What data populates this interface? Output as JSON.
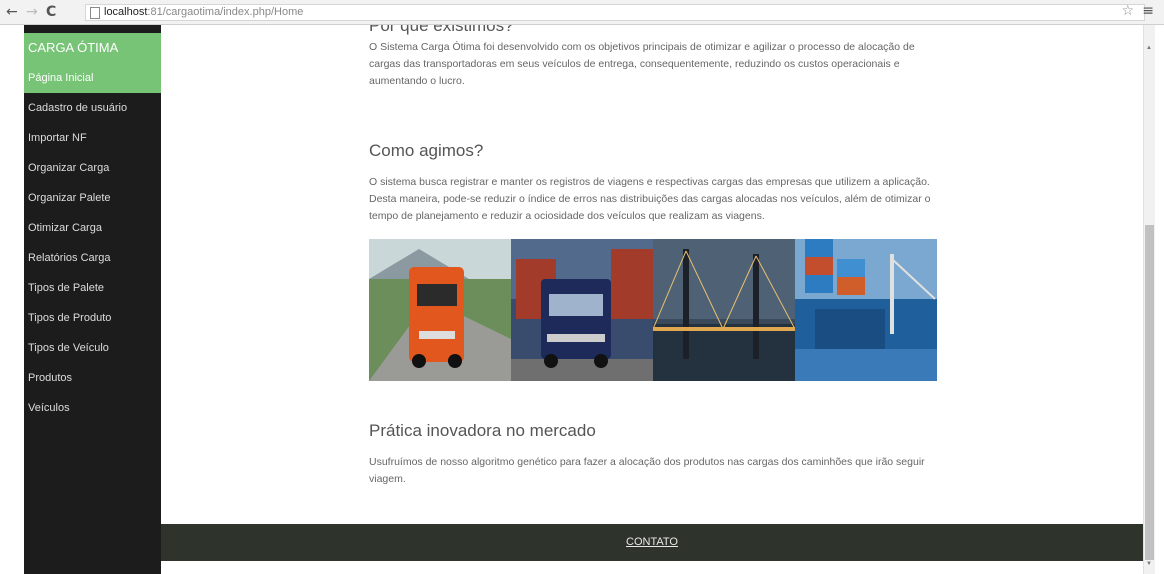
{
  "browser": {
    "url_host": "localhost",
    "url_path": ":81/cargaotima/index.php/Home"
  },
  "sidebar": {
    "brand": "CARGA ÓTIMA",
    "items": [
      {
        "label": "Página Inicial",
        "active": true
      },
      {
        "label": "Cadastro de usuário"
      },
      {
        "label": "Importar NF"
      },
      {
        "label": "Organizar Carga"
      },
      {
        "label": "Organizar Palete"
      },
      {
        "label": "Otimizar Carga"
      },
      {
        "label": "Relatórios Carga"
      },
      {
        "label": "Tipos de Palete"
      },
      {
        "label": "Tipos de Produto"
      },
      {
        "label": "Tipos de Veículo"
      },
      {
        "label": "Produtos"
      },
      {
        "label": "Veículos"
      }
    ]
  },
  "content": {
    "s1": {
      "heading": "Por que existimos?",
      "text": "O Sistema Carga Ótima foi desenvolvido com os objetivos principais de otimizar e agilizar o processo de alocação de cargas das transportadoras em seus veículos de entrega, consequentemente, reduzindo os custos operacionais e aumentando o lucro."
    },
    "s2": {
      "heading": "Como agimos?",
      "text": "O sistema busca registrar e manter os registros de viagens e respectivas cargas das empresas que utilizem a aplicação. Desta maneira, pode-se reduzir o índice de erros nas distribuições das cargas alocadas nos veículos, além de otimizar o tempo de planejamento e reduzir a ociosidade dos veículos que realizam as viagens."
    },
    "s3": {
      "heading": "Prática inovadora no mercado",
      "text": "Usufruímos de nosso algoritmo genético para fazer a alocação dos produtos nas cargas dos caminhões que irão seguir viagem."
    }
  },
  "footer": {
    "link": "CONTATO"
  },
  "colors": {
    "accent_green": "#77c476",
    "sidebar_bg": "#1c1c1c",
    "footer_bg": "#2e332c"
  }
}
